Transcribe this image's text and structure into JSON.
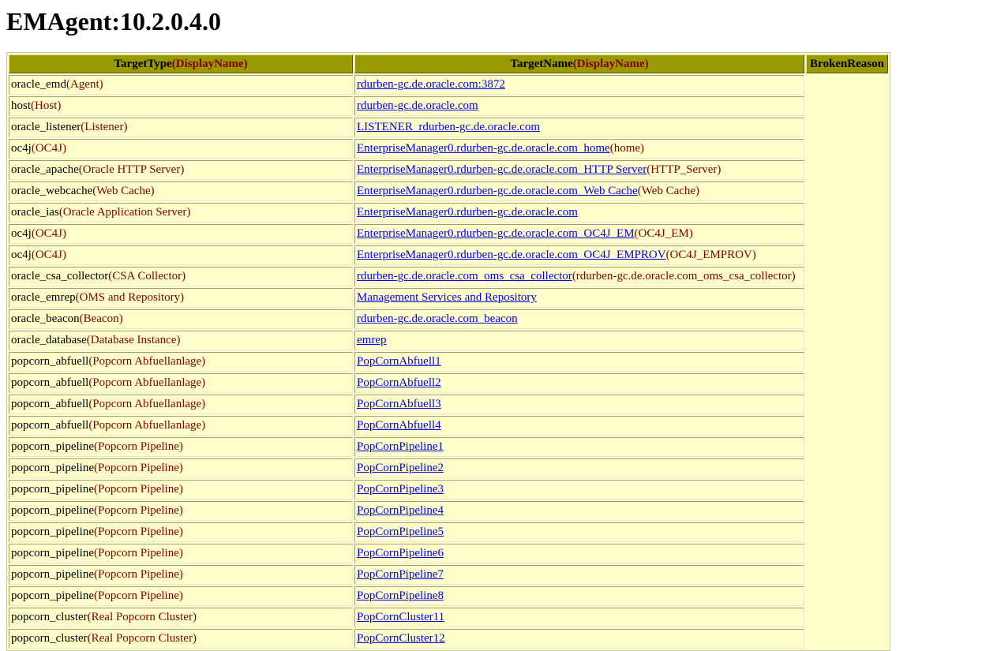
{
  "title": "EMAgent:10.2.0.4.0",
  "headers": {
    "type_label": "TargetType",
    "type_display": "(DisplayName)",
    "name_label": "TargetName",
    "name_display": "(DisplayName)",
    "broken": "BrokenReason"
  },
  "rows": [
    {
      "type": "oracle_emd",
      "type_display": "(Agent)",
      "name": "rdurben-gc.de.oracle.com:3872",
      "name_display": ""
    },
    {
      "type": "host",
      "type_display": "(Host)",
      "name": "rdurben-gc.de.oracle.com",
      "name_display": ""
    },
    {
      "type": "oracle_listener",
      "type_display": "(Listener)",
      "name": "LISTENER_rdurben-gc.de.oracle.com",
      "name_display": ""
    },
    {
      "type": "oc4j",
      "type_display": "(OC4J)",
      "name": "EnterpriseManager0.rdurben-gc.de.oracle.com_home",
      "name_display": "(home)"
    },
    {
      "type": "oracle_apache",
      "type_display": "(Oracle HTTP Server)",
      "name": "EnterpriseManager0.rdurben-gc.de.oracle.com_HTTP Server",
      "name_display": "(HTTP_Server)"
    },
    {
      "type": "oracle_webcache",
      "type_display": "(Web Cache)",
      "name": "EnterpriseManager0.rdurben-gc.de.oracle.com_Web Cache",
      "name_display": "(Web Cache)"
    },
    {
      "type": "oracle_ias",
      "type_display": "(Oracle Application Server)",
      "name": "EnterpriseManager0.rdurben-gc.de.oracle.com",
      "name_display": ""
    },
    {
      "type": "oc4j",
      "type_display": "(OC4J)",
      "name": "EnterpriseManager0.rdurben-gc.de.oracle.com_OC4J_EM",
      "name_display": "(OC4J_EM)"
    },
    {
      "type": "oc4j",
      "type_display": "(OC4J)",
      "name": "EnterpriseManager0.rdurben-gc.de.oracle.com_OC4J_EMPROV",
      "name_display": "(OC4J_EMPROV)"
    },
    {
      "type": "oracle_csa_collector",
      "type_display": "(CSA Collector)",
      "name": "rdurben-gc.de.oracle.com_oms_csa_collector",
      "name_display": "(rdurben-gc.de.oracle.com_oms_csa_collector)"
    },
    {
      "type": "oracle_emrep",
      "type_display": "(OMS and Repository)",
      "name": "Management Services and Repository",
      "name_display": ""
    },
    {
      "type": "oracle_beacon",
      "type_display": "(Beacon)",
      "name": "rdurben-gc.de.oracle.com_beacon",
      "name_display": ""
    },
    {
      "type": "oracle_database",
      "type_display": "(Database Instance)",
      "name": "emrep",
      "name_display": ""
    },
    {
      "type": "popcorn_abfuell",
      "type_display": "(Popcorn Abfuellanlage)",
      "name": "PopCornAbfuell1",
      "name_display": ""
    },
    {
      "type": "popcorn_abfuell",
      "type_display": "(Popcorn Abfuellanlage)",
      "name": "PopCornAbfuell2",
      "name_display": ""
    },
    {
      "type": "popcorn_abfuell",
      "type_display": "(Popcorn Abfuellanlage)",
      "name": "PopCornAbfuell3",
      "name_display": ""
    },
    {
      "type": "popcorn_abfuell",
      "type_display": "(Popcorn Abfuellanlage)",
      "name": "PopCornAbfuell4",
      "name_display": ""
    },
    {
      "type": "popcorn_pipeline",
      "type_display": "(Popcorn Pipeline)",
      "name": "PopCornPipeline1",
      "name_display": ""
    },
    {
      "type": "popcorn_pipeline",
      "type_display": "(Popcorn Pipeline)",
      "name": "PopCornPipeline2",
      "name_display": ""
    },
    {
      "type": "popcorn_pipeline",
      "type_display": "(Popcorn Pipeline)",
      "name": "PopCornPipeline3",
      "name_display": ""
    },
    {
      "type": "popcorn_pipeline",
      "type_display": "(Popcorn Pipeline)",
      "name": "PopCornPipeline4",
      "name_display": ""
    },
    {
      "type": "popcorn_pipeline",
      "type_display": "(Popcorn Pipeline)",
      "name": "PopCornPipeline5",
      "name_display": ""
    },
    {
      "type": "popcorn_pipeline",
      "type_display": "(Popcorn Pipeline)",
      "name": "PopCornPipeline6",
      "name_display": ""
    },
    {
      "type": "popcorn_pipeline",
      "type_display": "(Popcorn Pipeline)",
      "name": "PopCornPipeline7",
      "name_display": ""
    },
    {
      "type": "popcorn_pipeline",
      "type_display": "(Popcorn Pipeline)",
      "name": "PopCornPipeline8",
      "name_display": ""
    },
    {
      "type": "popcorn_cluster",
      "type_display": "(Real Popcorn Cluster)",
      "name": "PopCornCluster11",
      "name_display": ""
    },
    {
      "type": "popcorn_cluster",
      "type_display": "(Real Popcorn Cluster)",
      "name": "PopCornCluster12",
      "name_display": ""
    }
  ],
  "colors": {
    "header_bg": "#999900",
    "row_bg": "#ffffcc",
    "display_name": "#800000",
    "link": "#0000ee"
  }
}
